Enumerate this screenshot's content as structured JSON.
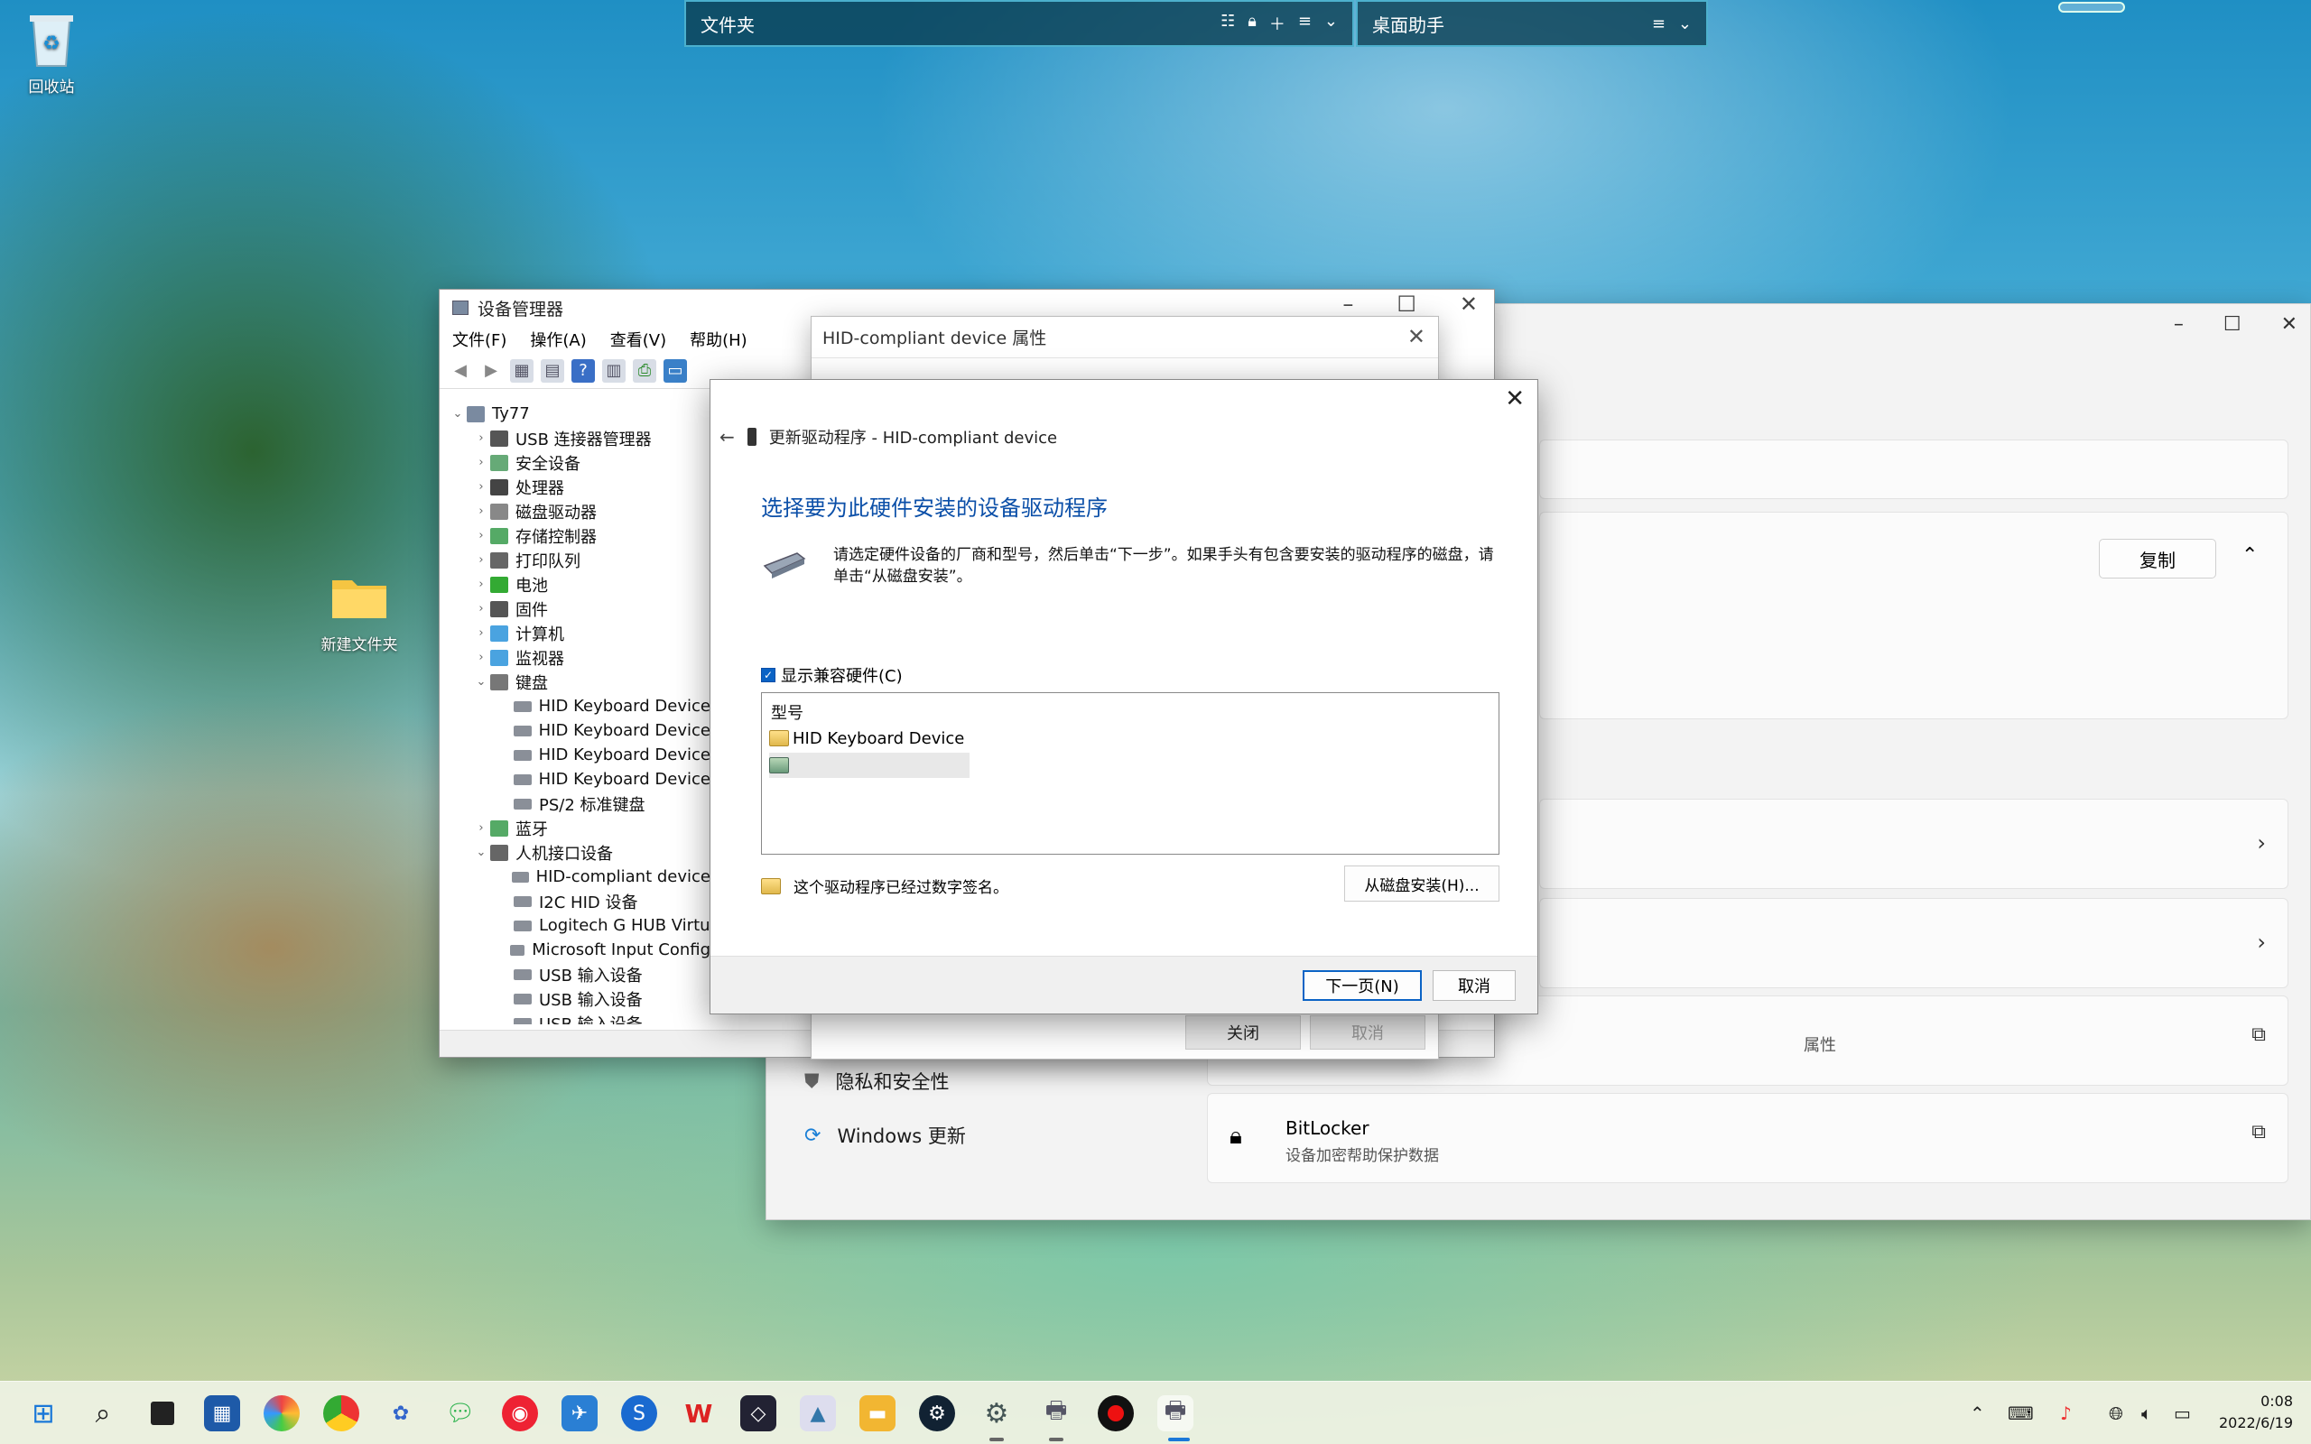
{
  "desktop": {
    "icons": [
      {
        "label": "回收站"
      },
      {
        "label": "新建文件夹"
      }
    ]
  },
  "fences": [
    {
      "title": "文件夹"
    },
    {
      "title": "桌面助手"
    }
  ],
  "settings": {
    "copy_label": "复制",
    "nav": [
      {
        "label": "隐私和安全性"
      },
      {
        "label": "Windows 更新"
      }
    ],
    "partial_text": "属性",
    "bitlocker": {
      "title": "BitLocker",
      "subtitle": "设备加密帮助保护数据"
    }
  },
  "device_manager": {
    "title": "设备管理器",
    "menu": [
      "文件(F)",
      "操作(A)",
      "查看(V)",
      "帮助(H)"
    ],
    "tree": [
      {
        "label": "Ty77",
        "level": 0,
        "expand": "v"
      },
      {
        "label": "USB 连接器管理器",
        "level": 1,
        "expand": ">"
      },
      {
        "label": "安全设备",
        "level": 1,
        "expand": ">"
      },
      {
        "label": "处理器",
        "level": 1,
        "expand": ">"
      },
      {
        "label": "磁盘驱动器",
        "level": 1,
        "expand": ">"
      },
      {
        "label": "存储控制器",
        "level": 1,
        "expand": ">"
      },
      {
        "label": "打印队列",
        "level": 1,
        "expand": ">"
      },
      {
        "label": "电池",
        "level": 1,
        "expand": ">"
      },
      {
        "label": "固件",
        "level": 1,
        "expand": ">"
      },
      {
        "label": "计算机",
        "level": 1,
        "expand": ">"
      },
      {
        "label": "监视器",
        "level": 1,
        "expand": ">"
      },
      {
        "label": "键盘",
        "level": 1,
        "expand": "v"
      },
      {
        "label": "HID Keyboard Device",
        "level": 2,
        "expand": ""
      },
      {
        "label": "HID Keyboard Device",
        "level": 2,
        "expand": ""
      },
      {
        "label": "HID Keyboard Device",
        "level": 2,
        "expand": ""
      },
      {
        "label": "HID Keyboard Device",
        "level": 2,
        "expand": ""
      },
      {
        "label": "PS/2 标准键盘",
        "level": 2,
        "expand": ""
      },
      {
        "label": "蓝牙",
        "level": 1,
        "expand": ">"
      },
      {
        "label": "人机接口设备",
        "level": 1,
        "expand": "v"
      },
      {
        "label": "HID-compliant device",
        "level": 2,
        "expand": ""
      },
      {
        "label": "I2C HID 设备",
        "level": 2,
        "expand": ""
      },
      {
        "label": "Logitech G HUB Virtu",
        "level": 2,
        "expand": ""
      },
      {
        "label": "Microsoft Input Config",
        "level": 2,
        "expand": ""
      },
      {
        "label": "USB 输入设备",
        "level": 2,
        "expand": ""
      },
      {
        "label": "USB 输入设备",
        "level": 2,
        "expand": ""
      },
      {
        "label": "USB 输入设备",
        "level": 2,
        "expand": ""
      }
    ]
  },
  "hid_properties": {
    "title": "HID-compliant device 属性",
    "close_label": "关闭",
    "cancel_label": "取消"
  },
  "update_driver": {
    "header": "更新驱动程序 - HID-compliant device",
    "heading": "选择要为此硬件安装的设备驱动程序",
    "description": "请选定硬件设备的厂商和型号，然后单击“下一步”。如果手头有包含要安装的驱动程序的磁盘，请单击“从磁盘安装”。",
    "show_compatible": "显示兼容硬件(C)",
    "list_header": "型号",
    "list_items": [
      "HID Keyboard Device",
      ""
    ],
    "signed_text": "这个驱动程序已经过数字签名。",
    "have_disk": "从磁盘安装(H)...",
    "next": "下一页(N)",
    "cancel": "取消"
  },
  "taskbar": {
    "time": "0:08",
    "date": "2022/6/19"
  }
}
